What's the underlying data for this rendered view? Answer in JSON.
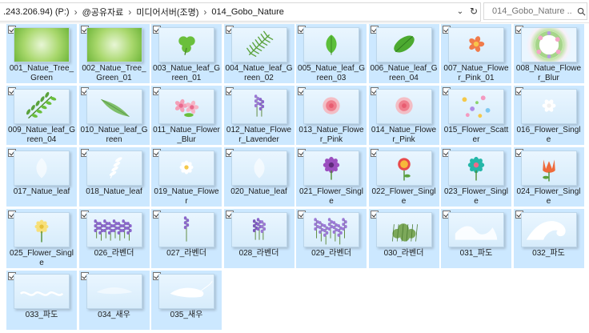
{
  "address": {
    "crumbs": [
      ".243.206.94) (P:)",
      "@공유자료",
      "미디어서버(조명)",
      "014_Gobo_Nature"
    ],
    "separator": "›",
    "dropdown_glyph": "⌄",
    "refresh_glyph": "↻",
    "search_placeholder": "014_Gobo_Nature ...",
    "search_icon": "search-icon"
  },
  "files": [
    {
      "label": "001_Natue_Tree_Green",
      "icon": "green-bokeh"
    },
    {
      "label": "002_Natue_Tree_Green_01",
      "icon": "green-bokeh"
    },
    {
      "label": "003_Natue_leaf_Green_01",
      "icon": "clover-leaf"
    },
    {
      "label": "004_Natue_leaf_Green_02",
      "icon": "fern-leaf"
    },
    {
      "label": "005_Natue_leaf_Green_03",
      "icon": "small-leaf"
    },
    {
      "label": "006_Natue_leaf_Green_04",
      "icon": "oval-leaf"
    },
    {
      "label": "007_Natue_Flower_Pink_01",
      "icon": "orange-flower"
    },
    {
      "label": "008_Natue_Flower_Blur",
      "icon": "flower-wreath"
    },
    {
      "label": "009_Natue_leaf_Green_04",
      "icon": "leaf-branch"
    },
    {
      "label": "010_Natue_leaf_Green",
      "icon": "long-leaf"
    },
    {
      "label": "011_Natue_Flower_Blur",
      "icon": "pink-flowers"
    },
    {
      "label": "012_Natue_Flower_Lavender",
      "icon": "lavender"
    },
    {
      "label": "013_Natue_Flower_Pink",
      "icon": "pink-rose"
    },
    {
      "label": "014_Natue_Flower_Pink",
      "icon": "pink-rose"
    },
    {
      "label": "015_Flower_Scatter",
      "icon": "scatter-flowers"
    },
    {
      "label": "016_Flower_Single",
      "icon": "white-flower"
    },
    {
      "label": "017_Natue_leaf",
      "icon": "faint-leaf"
    },
    {
      "label": "018_Natue_leaf",
      "icon": "white-leaf"
    },
    {
      "label": "019_Natue_Flower",
      "icon": "daisy"
    },
    {
      "label": "020_Natue_leaf",
      "icon": "faint-leaf"
    },
    {
      "label": "021_Flower_Single",
      "icon": "purple-flower"
    },
    {
      "label": "022_Flower_Single",
      "icon": "red-flower"
    },
    {
      "label": "023_Flower_Single",
      "icon": "teal-flower"
    },
    {
      "label": "024_Flower_Single",
      "icon": "tulip"
    },
    {
      "label": "025_Flower_Single",
      "icon": "yellow-flower"
    },
    {
      "label": "026_라벤더",
      "icon": "lavender-row"
    },
    {
      "label": "027_라벤더",
      "icon": "lavender-stem"
    },
    {
      "label": "028_라벤더",
      "icon": "lavender-bunch"
    },
    {
      "label": "029_라벤더",
      "icon": "lavender-field"
    },
    {
      "label": "030_라벤더",
      "icon": "herb-bush"
    },
    {
      "label": "031_파도",
      "icon": "wave"
    },
    {
      "label": "032_파도",
      "icon": "big-wave"
    },
    {
      "label": "033_파도",
      "icon": "wave-line"
    },
    {
      "label": "034_새우",
      "icon": "shrimp-faint"
    },
    {
      "label": "035_새우",
      "icon": "shrimp"
    }
  ],
  "colors": {
    "tile_selected": "#cce8ff",
    "tile_border": "#99d1ff"
  }
}
